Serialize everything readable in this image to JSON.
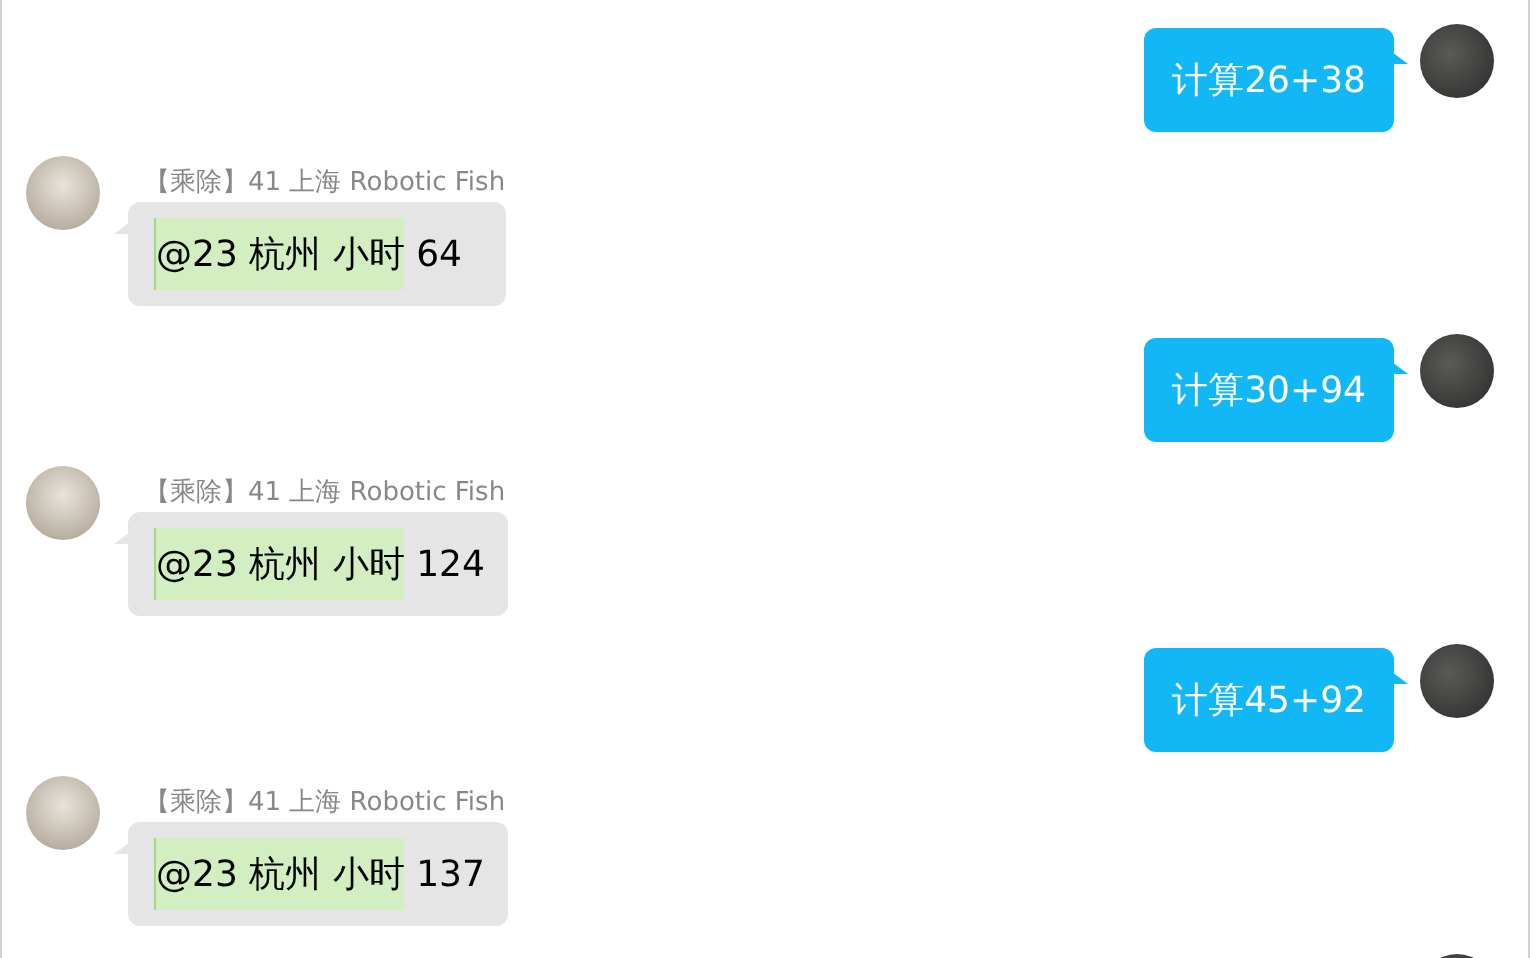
{
  "messages": [
    {
      "kind": "outgoing",
      "text": "计算26+38"
    },
    {
      "kind": "incoming",
      "sender": "【乘除】41 上海 Robotic Fish",
      "mention": "@23 杭州 小时",
      "text": "64"
    },
    {
      "kind": "outgoing",
      "text": "计算30+94"
    },
    {
      "kind": "incoming",
      "sender": "【乘除】41 上海 Robotic Fish",
      "mention": "@23 杭州 小时",
      "text": "124"
    },
    {
      "kind": "outgoing",
      "text": "计算45+92"
    },
    {
      "kind": "incoming",
      "sender": "【乘除】41 上海 Robotic Fish",
      "mention": "@23 杭州 小时",
      "text": "137"
    }
  ]
}
